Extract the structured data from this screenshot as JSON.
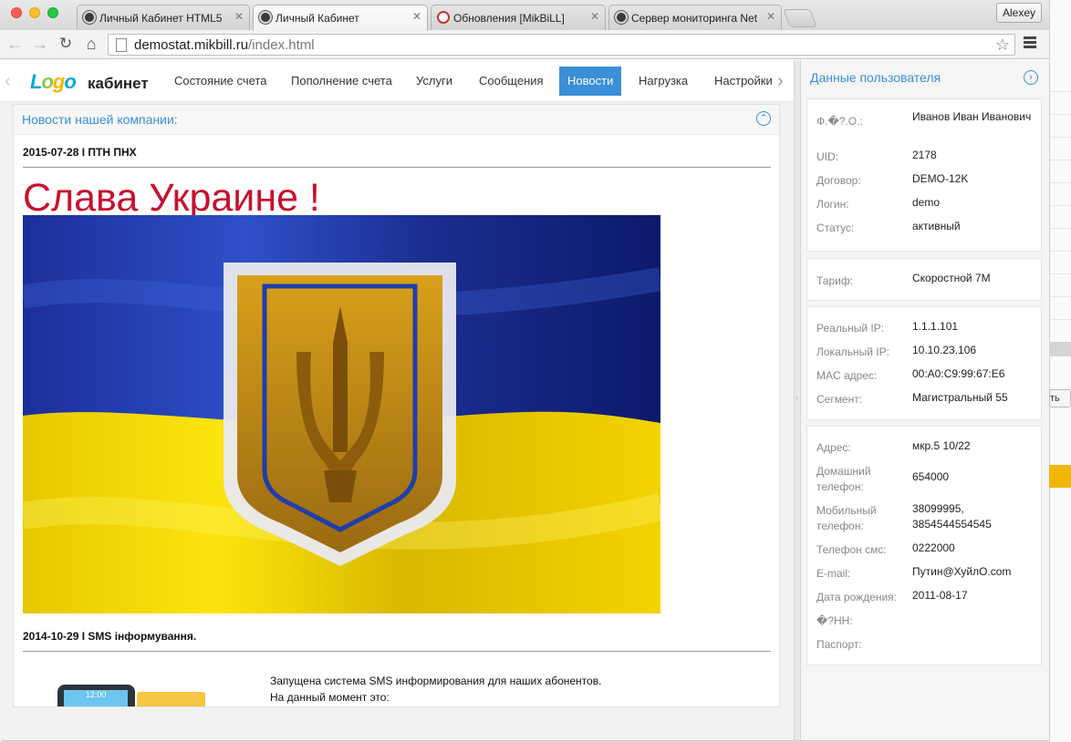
{
  "browser": {
    "tabs": [
      {
        "title": "Личный Кабинет HTML5",
        "active": false
      },
      {
        "title": "Личный Кабинет",
        "active": true
      },
      {
        "title": "Обновления [MikBiLL]",
        "active": false
      },
      {
        "title": "Сервер мониторинга Net",
        "active": false
      }
    ],
    "user_button": "Alexey",
    "url_host": "demostat.mikbill.ru",
    "url_path": "/index.html"
  },
  "nav": {
    "logo_mark": "Logo",
    "logo_text": "кабинет",
    "items": [
      {
        "label": "Состояние счета"
      },
      {
        "label": "Пополнение счета"
      },
      {
        "label": "Услуги"
      },
      {
        "label": "Сообщения"
      },
      {
        "label": "Новости"
      },
      {
        "label": "Нагрузка"
      },
      {
        "label": "Настройки"
      }
    ],
    "active_item": "Новости"
  },
  "news": {
    "panel_title": "Новости нашей компании:",
    "items": [
      {
        "date_title": "2015-07-28 I ПТН ПНХ",
        "headline": "Слава Украине !"
      },
      {
        "date_title": "2014-10-29 I SMS інформування.",
        "body": [
          "Запущена система SMS информирования для наших абонентов.",
          "На данный момент это:"
        ]
      }
    ],
    "sms_image_text": "12:00"
  },
  "sidebar": {
    "title": "Данные пользователя",
    "personal": [
      {
        "label": "Ф.�?.О.:",
        "value": "Иванов Иван Иванович"
      },
      {
        "label": "UID:",
        "value": "2178"
      },
      {
        "label": "Договор:",
        "value": "DEMO-12K"
      },
      {
        "label": "Логин:",
        "value": "demo"
      },
      {
        "label": "Статус:",
        "value": "активный"
      }
    ],
    "tariff": [
      {
        "label": "Тариф:",
        "value": "Скоростной 7M"
      }
    ],
    "network": [
      {
        "label": "Реальный IP:",
        "value": "1.1.1.101"
      },
      {
        "label": "Локальный IP:",
        "value": "10.10.23.106"
      },
      {
        "label": "MAC адрес:",
        "value": "00:A0:C9:99:67:E6"
      },
      {
        "label": "Сегмент:",
        "value": "Магистральный 55"
      }
    ],
    "contacts": [
      {
        "label": "Адрес:",
        "value": "мкр.5 10/22"
      },
      {
        "label": "Домашний телефон:",
        "value": "654000"
      },
      {
        "label": "Мобильный телефон:",
        "value": "38099995, 3854544554545"
      },
      {
        "label": "Телефон смс:",
        "value": "0222000"
      },
      {
        "label": "E-mail:",
        "value": "Путин@ХуйлО.com"
      },
      {
        "label": "Дата рождения:",
        "value": "2011-08-17"
      },
      {
        "label": "�?НН:",
        "value": ""
      },
      {
        "label": "Паспорт:",
        "value": ""
      }
    ]
  },
  "fringe": {
    "button_text": "ть"
  },
  "colors": {
    "accent": "#3a8fd6",
    "headline": "#c8102e",
    "flag_blue": "#1f3fa8",
    "flag_yellow": "#f5d90a"
  }
}
